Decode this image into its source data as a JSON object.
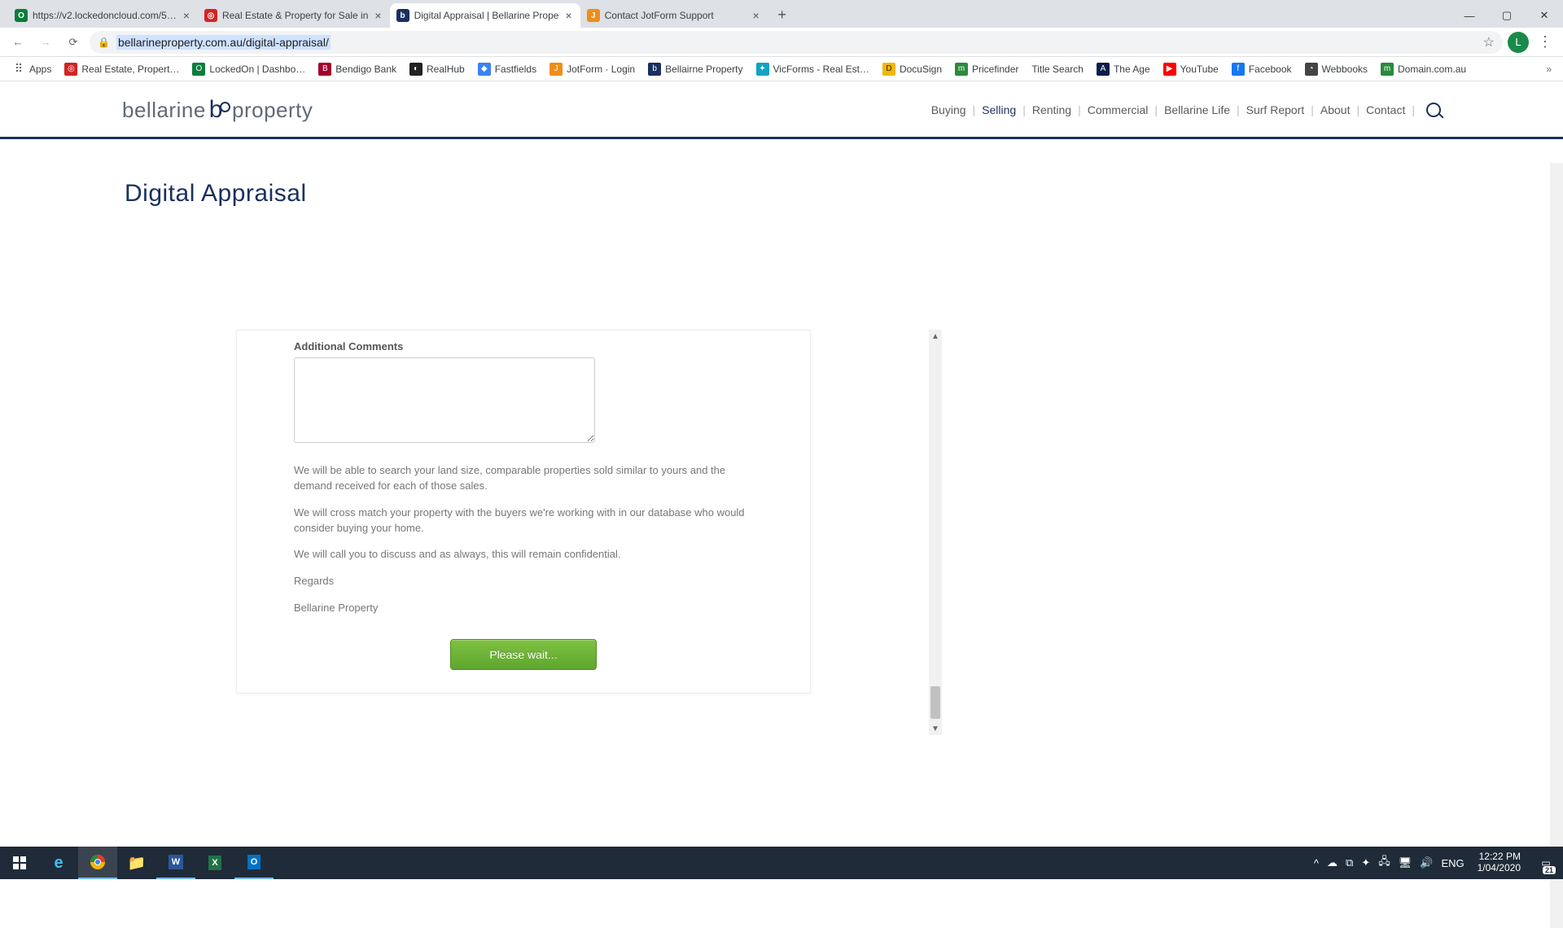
{
  "browser": {
    "tabs": [
      {
        "title": "https://v2.lockedoncloud.com/5…",
        "fav_bg": "#0a7d3b",
        "fav_fg": "#fff",
        "fav_txt": "O",
        "active": false
      },
      {
        "title": "Real Estate & Property for Sale in",
        "fav_bg": "#d32323",
        "fav_fg": "#fff",
        "fav_txt": "◎",
        "active": false
      },
      {
        "title": "Digital Appraisal | Bellarine Prope",
        "fav_bg": "#19305f",
        "fav_fg": "#fff",
        "fav_txt": "b",
        "active": true
      },
      {
        "title": "Contact JotForm Support",
        "fav_bg": "#f08c1a",
        "fav_fg": "#fff",
        "fav_txt": "J",
        "active": false
      }
    ],
    "url": "bellarineproperty.com.au/digital-appraisal/",
    "avatar_letter": "L"
  },
  "bookmarks": [
    {
      "label": "Apps",
      "ico_bg": "",
      "ico_txt": "⠿",
      "ico_fg": "#5f6368"
    },
    {
      "label": "Real Estate, Propert…",
      "ico_bg": "#d32323",
      "ico_txt": "◎",
      "ico_fg": "#fff"
    },
    {
      "label": "LockedOn | Dashbo…",
      "ico_bg": "#0a7d3b",
      "ico_txt": "O",
      "ico_fg": "#fff"
    },
    {
      "label": "Bendigo Bank",
      "ico_bg": "#a4002b",
      "ico_txt": "B",
      "ico_fg": "#fff"
    },
    {
      "label": "RealHub",
      "ico_bg": "#222",
      "ico_txt": "◐",
      "ico_fg": "#fff"
    },
    {
      "label": "Fastfields",
      "ico_bg": "#3b82f6",
      "ico_txt": "◆",
      "ico_fg": "#fff"
    },
    {
      "label": "JotForm · Login",
      "ico_bg": "#f08c1a",
      "ico_txt": "J",
      "ico_fg": "#fff"
    },
    {
      "label": "Bellairne Property",
      "ico_bg": "#19305f",
      "ico_txt": "b",
      "ico_fg": "#fff"
    },
    {
      "label": "VicForms - Real Est…",
      "ico_bg": "#12a3c4",
      "ico_txt": "✦",
      "ico_fg": "#fff"
    },
    {
      "label": "DocuSign",
      "ico_bg": "#f2b705",
      "ico_txt": "D",
      "ico_fg": "#222"
    },
    {
      "label": "Pricefinder",
      "ico_bg": "#2a8a3a",
      "ico_txt": "m",
      "ico_fg": "#fff"
    },
    {
      "label": "Title Search",
      "ico_bg": "",
      "ico_txt": "",
      "ico_fg": ""
    },
    {
      "label": "The Age",
      "ico_bg": "#0a1e4a",
      "ico_txt": "A",
      "ico_fg": "#fff"
    },
    {
      "label": "YouTube",
      "ico_bg": "#ff0000",
      "ico_txt": "▶",
      "ico_fg": "#fff"
    },
    {
      "label": "Facebook",
      "ico_bg": "#1877f2",
      "ico_txt": "f",
      "ico_fg": "#fff"
    },
    {
      "label": "Webbooks",
      "ico_bg": "#444",
      "ico_txt": "◔",
      "ico_fg": "#fff"
    },
    {
      "label": "Domain.com.au",
      "ico_bg": "#2a8a3a",
      "ico_txt": "m",
      "ico_fg": "#fff"
    }
  ],
  "site": {
    "brand_a": "bellarine",
    "brand_b": "property",
    "nav": [
      "Buying",
      "Selling",
      "Renting",
      "Commercial",
      "Bellarine Life",
      "Surf Report",
      "About",
      "Contact"
    ],
    "nav_active_index": 1,
    "page_title": "Digital Appraisal"
  },
  "form": {
    "comments_label": "Additional Comments",
    "p1": "We will be able to search your land size, comparable properties sold similar to yours and the demand received for each of those sales.",
    "p2": "We will cross match your property with the buyers we're working with in our database who would consider buying your home.",
    "p3": "We will call you to discuss and as always, this will remain confidential.",
    "p4": "Regards",
    "p5": "Bellarine Property",
    "submit_label": "Please wait..."
  },
  "taskbar": {
    "lang": "ENG",
    "time": "12:22 PM",
    "date": "1/04/2020",
    "notif_count": "21"
  }
}
